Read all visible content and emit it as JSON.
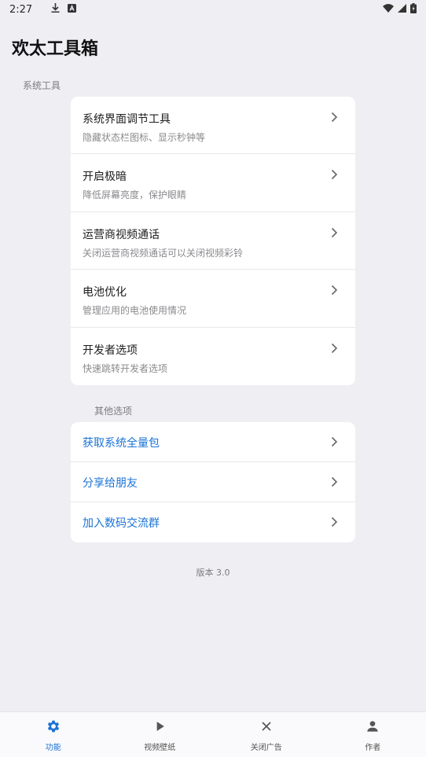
{
  "status_bar": {
    "time": "2:27",
    "icons": [
      "download-icon",
      "a-box-icon",
      "wifi-icon",
      "signal-icon",
      "battery-icon"
    ]
  },
  "app": {
    "title": "欢太工具箱"
  },
  "sections": {
    "system": {
      "label": "系统工具",
      "items": [
        {
          "title": "系统界面调节工具",
          "subtitle": "隐藏状态栏图标、显示秒钟等"
        },
        {
          "title": "开启极暗",
          "subtitle": "降低屏幕亮度，保护眼睛"
        },
        {
          "title": "运营商视频通话",
          "subtitle": "关闭运营商视频通话可以关闭视频彩铃"
        },
        {
          "title": "电池优化",
          "subtitle": "管理应用的电池使用情况"
        },
        {
          "title": "开发者选项",
          "subtitle": "快速跳转开发者选项"
        }
      ]
    },
    "other": {
      "label": "其他选项",
      "items": [
        {
          "title": "获取系统全量包"
        },
        {
          "title": "分享给朋友"
        },
        {
          "title": "加入数码交流群"
        }
      ]
    }
  },
  "version": "版本 3.0",
  "bottom_nav": {
    "items": [
      {
        "label": "功能",
        "icon": "gear-icon",
        "active": true
      },
      {
        "label": "视频壁纸",
        "icon": "play-icon",
        "active": false
      },
      {
        "label": "关闭广告",
        "icon": "close-icon",
        "active": false
      },
      {
        "label": "作者",
        "icon": "person-icon",
        "active": false
      }
    ]
  },
  "colors": {
    "background": "#efeef3",
    "accent": "#1a73d6",
    "card": "#ffffff",
    "subtext": "#8a8a8e"
  }
}
